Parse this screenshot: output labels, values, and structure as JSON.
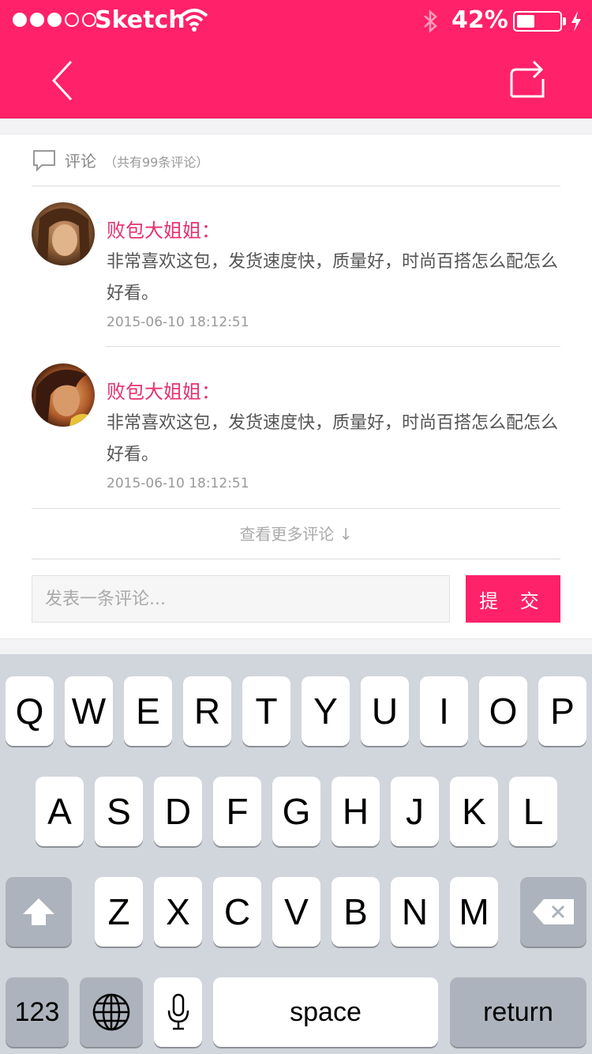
{
  "status_bar": {
    "carrier": "Sketch",
    "battery_pct": "42%",
    "battery_level": 0.42
  },
  "nav": {
    "back_icon": "chevron-left-icon",
    "share_icon": "share-icon"
  },
  "comments": {
    "title": "评论",
    "count_text": "（共有99条评论）",
    "items": [
      {
        "name": "败包大姐姐：",
        "text": "非常喜欢这包，发货速度快，质量好，时尚百搭怎么配怎么好看。",
        "time": "2015-06-10  18:12:51"
      },
      {
        "name": "败包大姐姐：",
        "text": "非常喜欢这包，发货速度快，质量好，时尚百搭怎么配怎么好看。",
        "time": "2015-06-10  18:12:51"
      }
    ],
    "more": "查看更多评论 ↓",
    "input_placeholder": "发表一条评论...",
    "submit": "提 交"
  },
  "keyboard": {
    "row1": [
      "Q",
      "W",
      "E",
      "R",
      "T",
      "Y",
      "U",
      "I",
      "O",
      "P"
    ],
    "row2": [
      "A",
      "S",
      "D",
      "F",
      "G",
      "H",
      "J",
      "K",
      "L"
    ],
    "row3": [
      "Z",
      "X",
      "C",
      "V",
      "B",
      "N",
      "M"
    ],
    "num_key": "123",
    "space": "space",
    "return": "return"
  },
  "colors": {
    "accent": "#ff2169",
    "name": "#e8306e",
    "keyboard_bg": "#d1d5dc"
  }
}
